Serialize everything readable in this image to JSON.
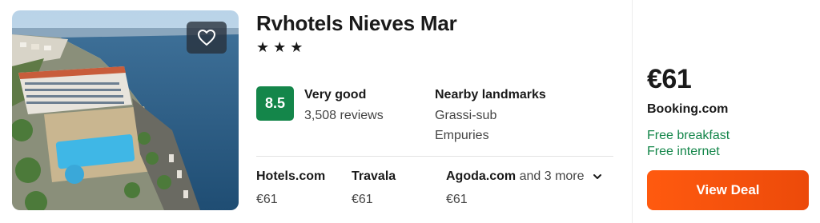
{
  "hotel": {
    "name": "Rvhotels Nieves Mar",
    "stars": "★★★",
    "rating": {
      "score": "8.5",
      "label": "Very good",
      "reviews": "3,508 reviews",
      "color": "#14864a"
    },
    "landmarks": {
      "title": "Nearby landmarks",
      "items": [
        "Grassi-sub",
        "Empuries"
      ]
    }
  },
  "favorite": {
    "icon": "heart-outline-icon"
  },
  "providers": [
    {
      "name": "Hotels.com",
      "price": "€61"
    },
    {
      "name": "Travala",
      "price": "€61"
    },
    {
      "name": "Agoda.com",
      "more": "and 3 more",
      "price": "€61",
      "icon": "chevron-down-icon"
    }
  ],
  "deal": {
    "price": "€61",
    "provider": "Booking.com",
    "amenities": [
      "Free breakfast",
      "Free internet"
    ],
    "button_label": "View Deal",
    "button_color": "#ff5a0f"
  }
}
